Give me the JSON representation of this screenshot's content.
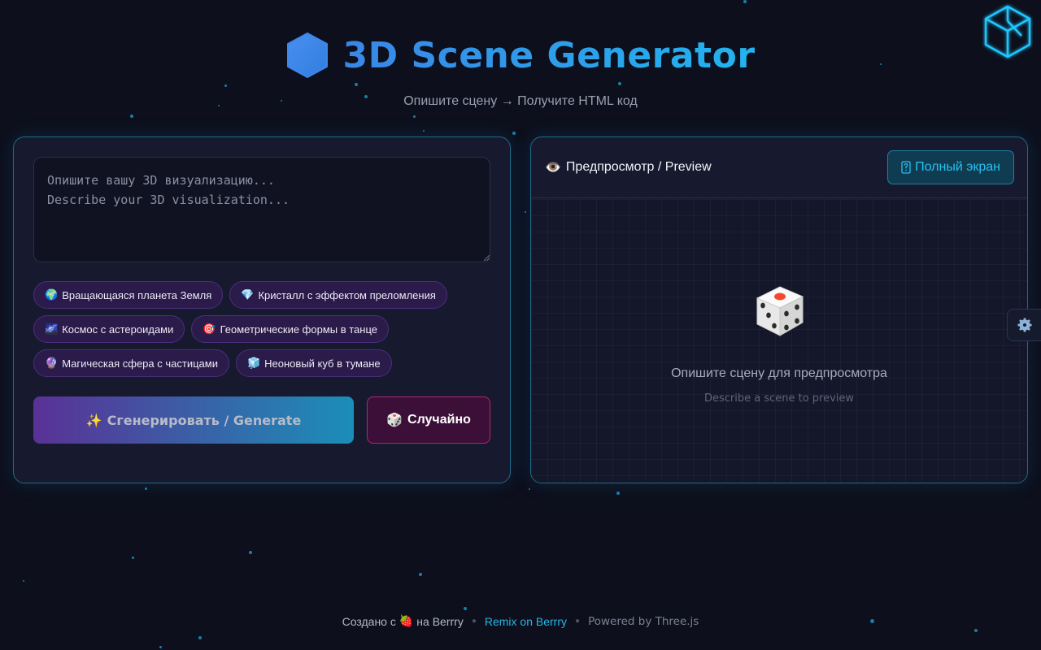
{
  "header": {
    "title": "3D Scene Generator",
    "subtitle": "Опишите сцену → Получите HTML код"
  },
  "editor": {
    "placeholder": "Опишите вашу 3D визуализацию...\nDescribe your 3D visualization..."
  },
  "suggestions": [
    {
      "icon": "🌍",
      "label": "Вращающаяся планета Земля"
    },
    {
      "icon": "💎",
      "label": "Кристалл с эффектом преломления"
    },
    {
      "icon": "🌌",
      "label": "Космос с астероидами"
    },
    {
      "icon": "🎯",
      "label": "Геометрические формы в танце"
    },
    {
      "icon": "🔮",
      "label": "Магическая сфера с частицами"
    },
    {
      "icon": "🧊",
      "label": "Неоновый куб в тумане"
    }
  ],
  "actions": {
    "generate_icon": "✨",
    "generate_label": "Сгенерировать / Generate",
    "random_icon": "🎲",
    "random_label": "Случайно"
  },
  "preview": {
    "icon": "👁️",
    "title": "Предпросмотр / Preview",
    "fullscreen_label": "Полный экран",
    "empty_title": "Опишите сцену для предпросмотра",
    "empty_subtitle": "Describe a scene to preview"
  },
  "footer": {
    "made_prefix": "Создано с",
    "made_icon": "🍓",
    "made_suffix": "на Berrry",
    "remix_label": "Remix on Berrry",
    "powered_label": "Powered by Three.js"
  },
  "colors": {
    "background": "#0d0f1c",
    "panel": "#171a2e",
    "accent_cyan": "#22b8e8",
    "accent_purple": "#5a3196",
    "accent_pink": "#b0267a"
  }
}
